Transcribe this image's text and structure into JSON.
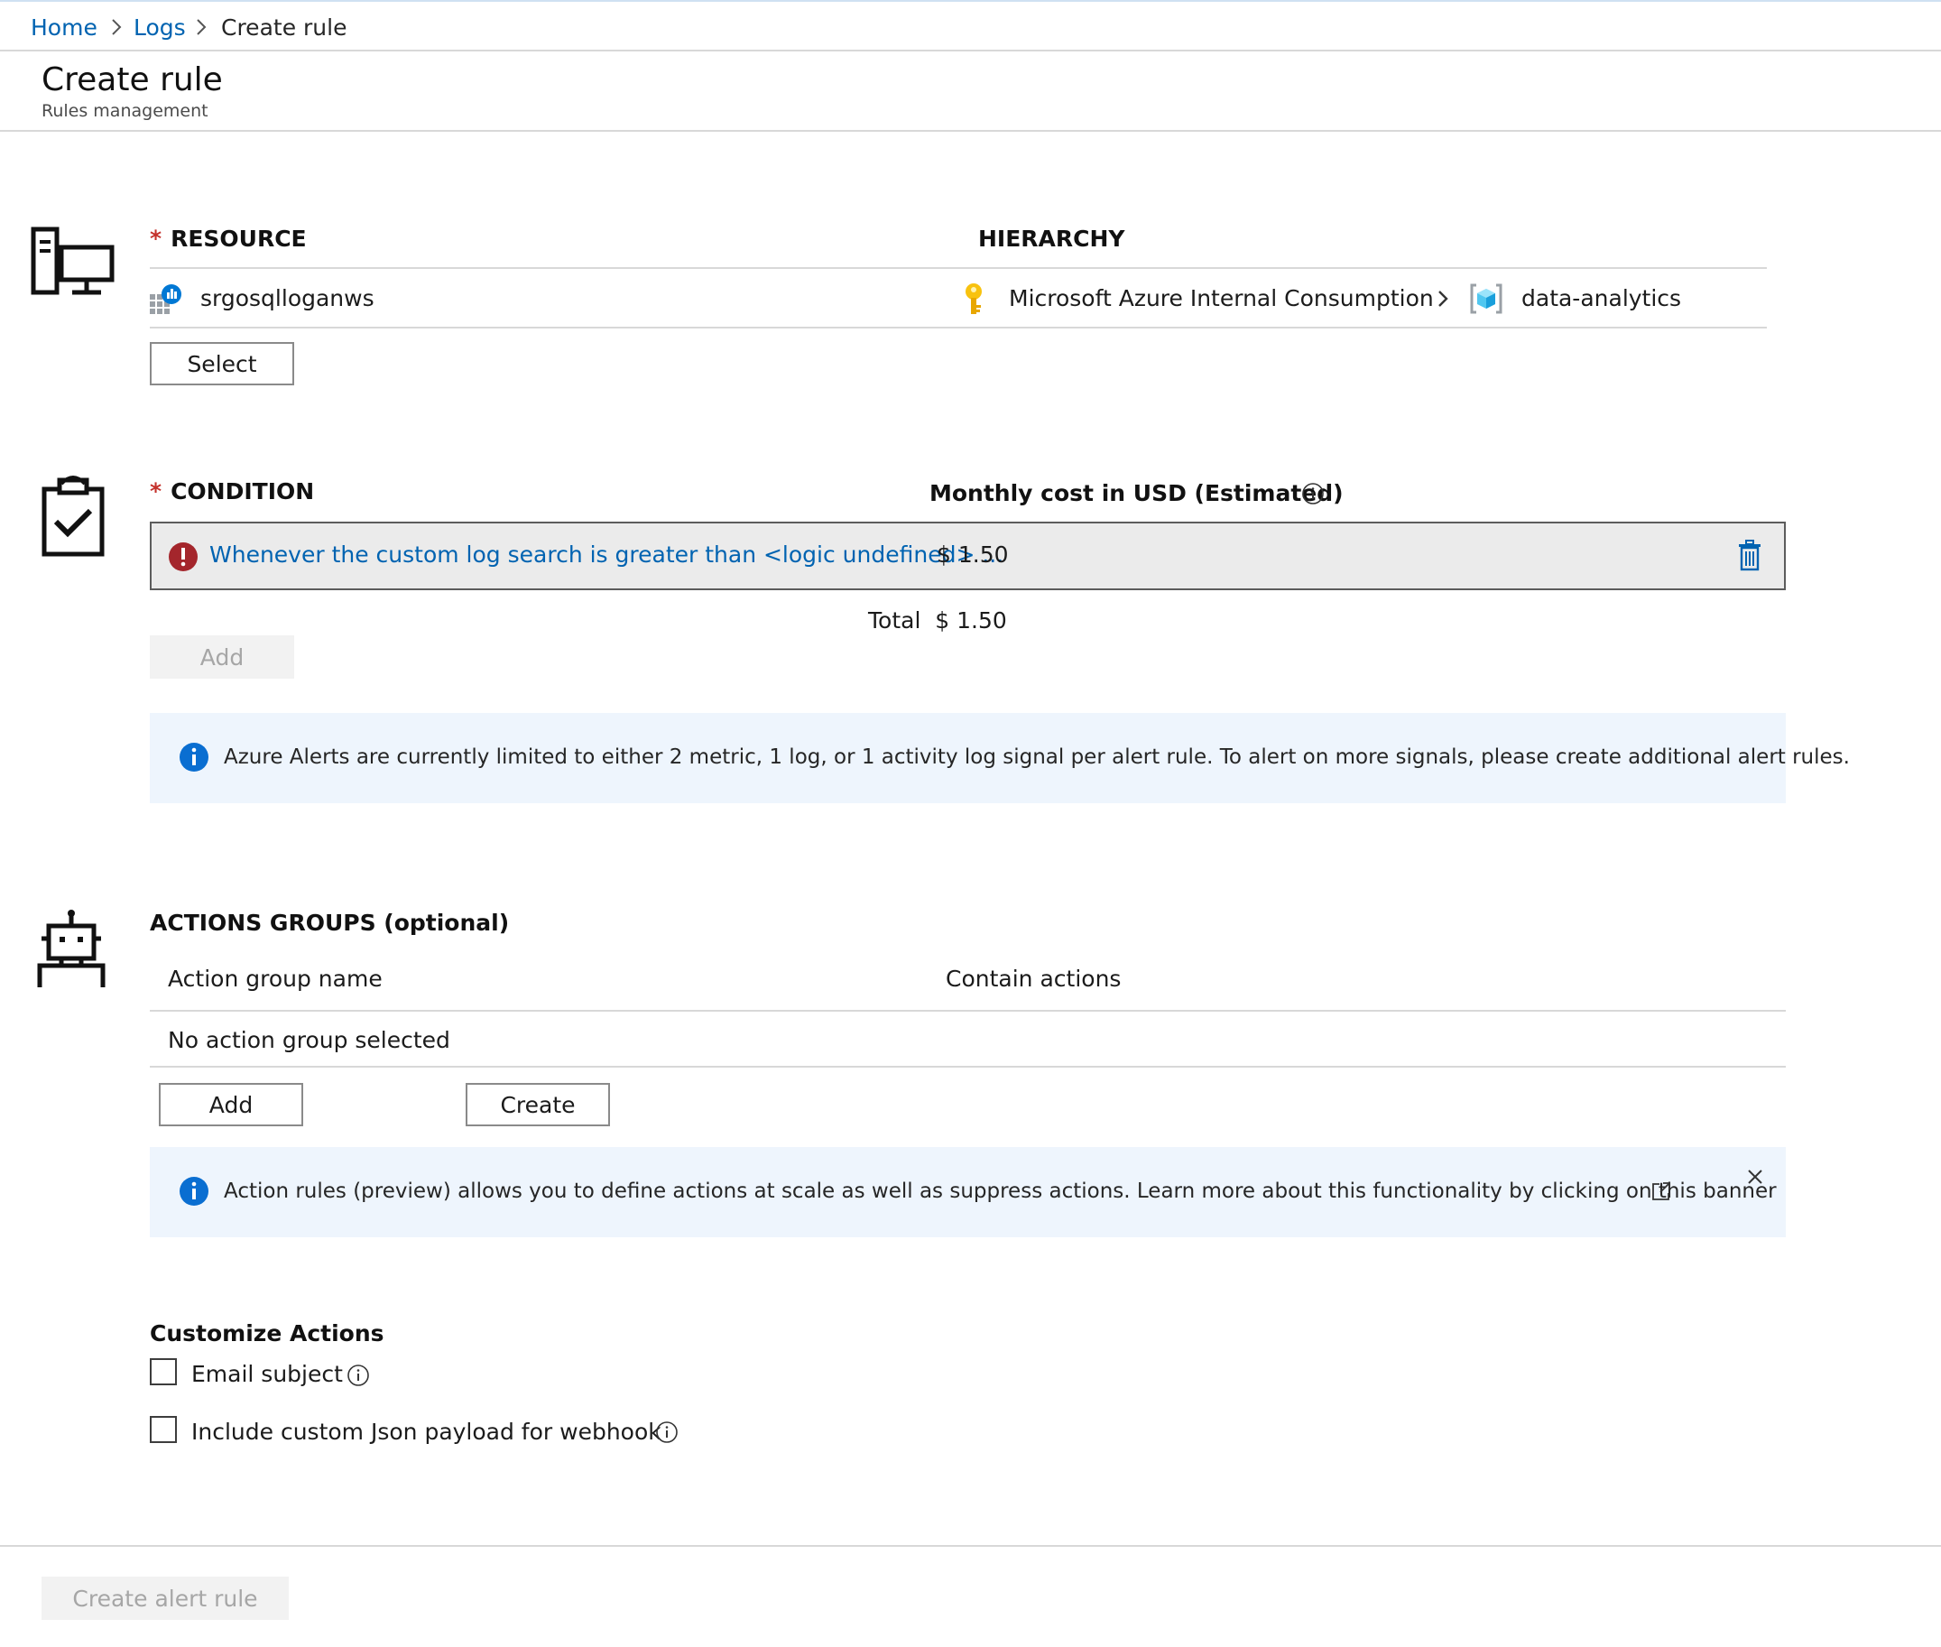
{
  "breadcrumb": {
    "home": "Home",
    "logs": "Logs",
    "current": "Create rule"
  },
  "header": {
    "title": "Create rule",
    "subtitle": "Rules management"
  },
  "resource": {
    "label": "RESOURCE",
    "hierarchy_label": "HIERARCHY",
    "name": "srgosqlloganws",
    "subscription": "Microsoft Azure Internal Consumption",
    "resource_group": "data-analytics",
    "select_label": "Select"
  },
  "condition": {
    "label": "CONDITION",
    "cost_label": "Monthly cost in USD (Estimated)",
    "item_text": "Whenever the custom log search is greater than <logic undefined> ...",
    "item_cost": "$ 1.50",
    "total_label": "Total",
    "total_value": "$ 1.50",
    "add_label": "Add",
    "info": "Azure Alerts are currently limited to either 2 metric, 1 log, or 1 activity log signal per alert rule. To alert on more signals, please create additional alert rules."
  },
  "actions": {
    "label": "ACTIONS GROUPS (optional)",
    "col_name": "Action group name",
    "col_actions": "Contain actions",
    "empty": "No action group selected",
    "add_label": "Add",
    "create_label": "Create",
    "banner": "Action rules (preview) allows you to define actions at scale as well as suppress actions. Learn more about this functionality by clicking on this banner"
  },
  "customize": {
    "label": "Customize Actions",
    "email_subject": "Email subject",
    "webhook_payload": "Include custom Json payload for webhook"
  },
  "footer": {
    "create_label": "Create alert rule"
  },
  "colors": {
    "link": "#0063b1",
    "required": "#c4312b",
    "info": "#0a6ed1",
    "error": "#a4262c",
    "banner_bg": "#eef5fd",
    "disabled_bg": "#f2f2f2"
  }
}
